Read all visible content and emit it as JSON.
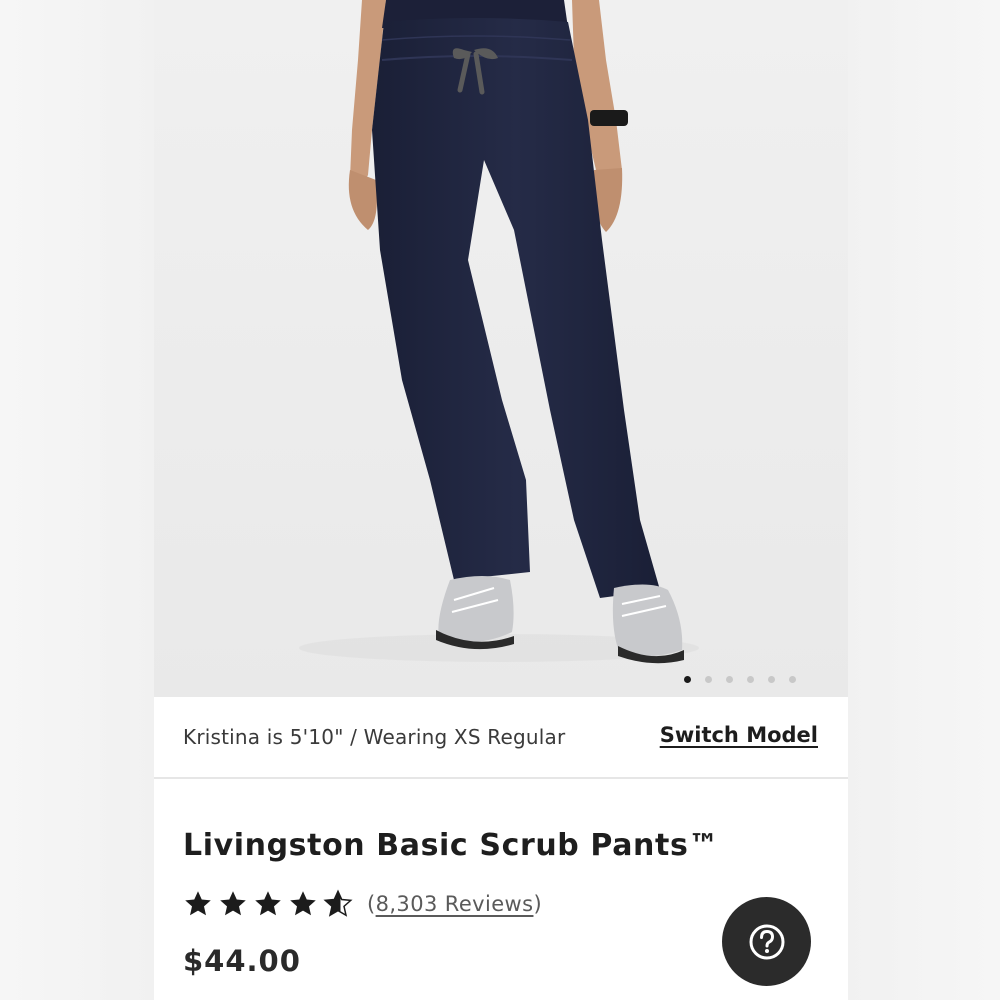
{
  "gallery": {
    "image_alt": "Navy Livingston Basic Scrub Pants worn by model with grey sneakers",
    "slide_count": 6,
    "active_slide": 1
  },
  "model": {
    "info": "Kristina is 5'10\" / Wearing XS Regular",
    "switch_label": "Switch Model"
  },
  "product": {
    "title": "Livingston Basic Scrub Pants™",
    "rating": 4.5,
    "rating_max": 5,
    "reviews_open": "(",
    "reviews_label": "8,303 Reviews",
    "reviews_close": ")",
    "price": "$44.00"
  },
  "help": {
    "icon": "question-circle-icon"
  },
  "colors": {
    "pants": "#1f2540",
    "text_dark": "#1e1e1e",
    "help_bg": "#2b2b2b"
  }
}
